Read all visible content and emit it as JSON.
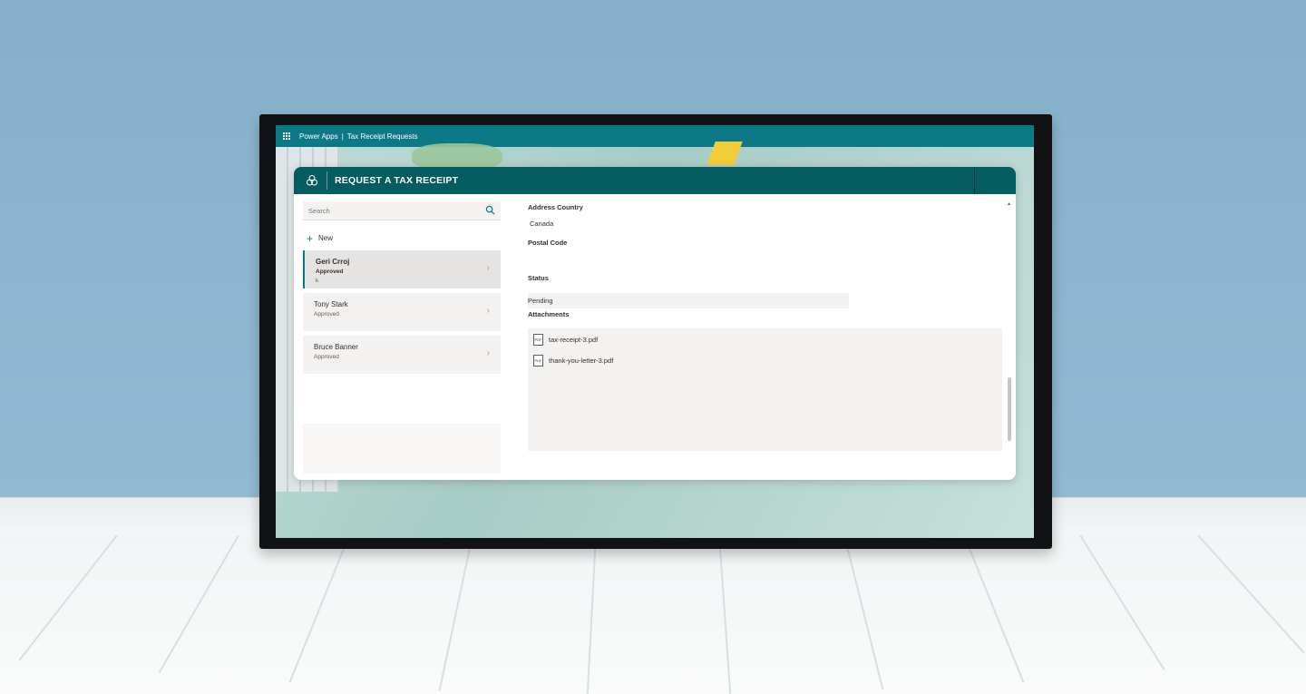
{
  "topbar": {
    "app_name": "Power Apps",
    "separator": "|",
    "page_name": "Tax Receipt Requests"
  },
  "header": {
    "title": "REQUEST A TAX RECEIPT",
    "logo_icon": "logo-icon"
  },
  "search": {
    "placeholder": "Search"
  },
  "new_button": {
    "label": "New"
  },
  "records": [
    {
      "name": "Geri Crroj",
      "status": "Approved",
      "extra": "k",
      "selected": true
    },
    {
      "name": "Tony Stark",
      "status": "Approved",
      "extra": "",
      "selected": false
    },
    {
      "name": "Bruce Banner",
      "status": "Approved",
      "extra": "",
      "selected": false
    }
  ],
  "form": {
    "address_country": {
      "label": "Address Country",
      "value": "Canada"
    },
    "postal_code": {
      "label": "Postal Code",
      "value": ""
    },
    "status": {
      "label": "Status",
      "value": "Pending"
    },
    "attachments": {
      "label": "Attachments",
      "files": [
        "tax-receipt-3.pdf",
        "thank-you-letter-3.pdf"
      ]
    }
  },
  "colors": {
    "topbar": "#0b7a86",
    "header": "#035c5f",
    "accent": "#0b7a86"
  }
}
